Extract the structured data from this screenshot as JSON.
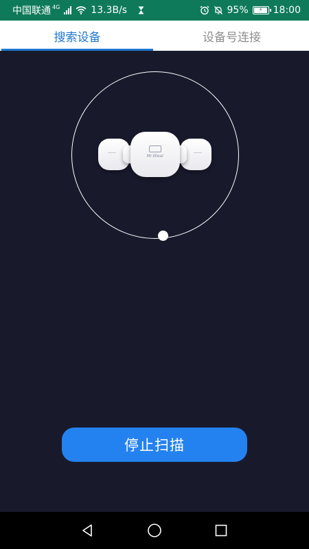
{
  "status_bar": {
    "carrier": "中国联通",
    "network_type": "4G",
    "speed": "13.3B/s",
    "battery": "95%",
    "time": "18:00",
    "icons": [
      "signal-icon",
      "wifi-icon",
      "hourglass-icon",
      "alarm-icon",
      "mute-icon",
      "battery-icon"
    ]
  },
  "tabs": [
    {
      "label": "搜索设备",
      "active": true
    },
    {
      "label": "设备号连接",
      "active": false
    }
  ],
  "scan": {
    "device_logo_text": "Mr.Wear"
  },
  "actions": {
    "stop_scan_label": "停止扫描"
  },
  "nav_bar": {
    "icons": [
      "back-icon",
      "home-icon",
      "recents-icon"
    ]
  },
  "colors": {
    "status_bar": "#0f7a5a",
    "accent": "#1f78d1",
    "button": "#2482f0",
    "background": "#181a2c"
  }
}
